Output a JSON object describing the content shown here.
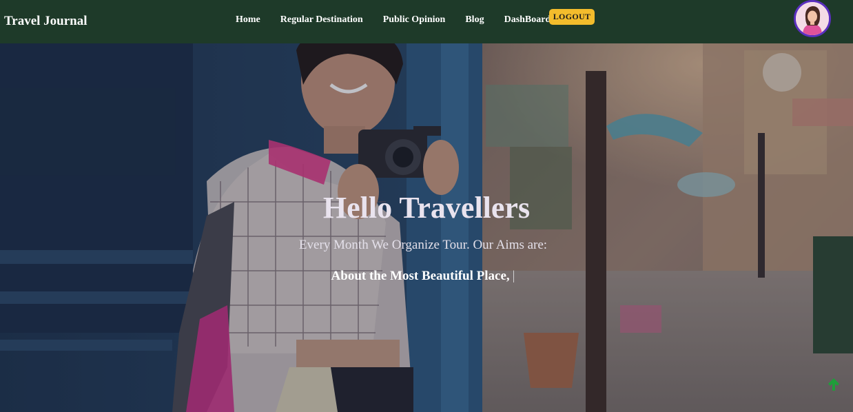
{
  "navbar": {
    "brand": "Travel Journal",
    "links": [
      {
        "label": "Home"
      },
      {
        "label": "Regular Destination"
      },
      {
        "label": "Public Opinion"
      },
      {
        "label": "Blog"
      },
      {
        "label": "DashBoard"
      }
    ],
    "logout_label": "LOGOUT",
    "avatar_icon": "user-avatar"
  },
  "hero": {
    "title": "Hello Travellers",
    "subtitle": "Every Month We Organize Tour. Our Aims are:",
    "typed_text": "About the Most Beautiful Place,",
    "cursor": "|"
  },
  "scroll_top": {
    "icon": "arrow-up-icon"
  },
  "colors": {
    "navbar_bg": "#1e3a29",
    "logout_bg": "#f3bc2c",
    "avatar_border": "#5a2fbf",
    "scroll_arrow": "#1f9e3a"
  }
}
